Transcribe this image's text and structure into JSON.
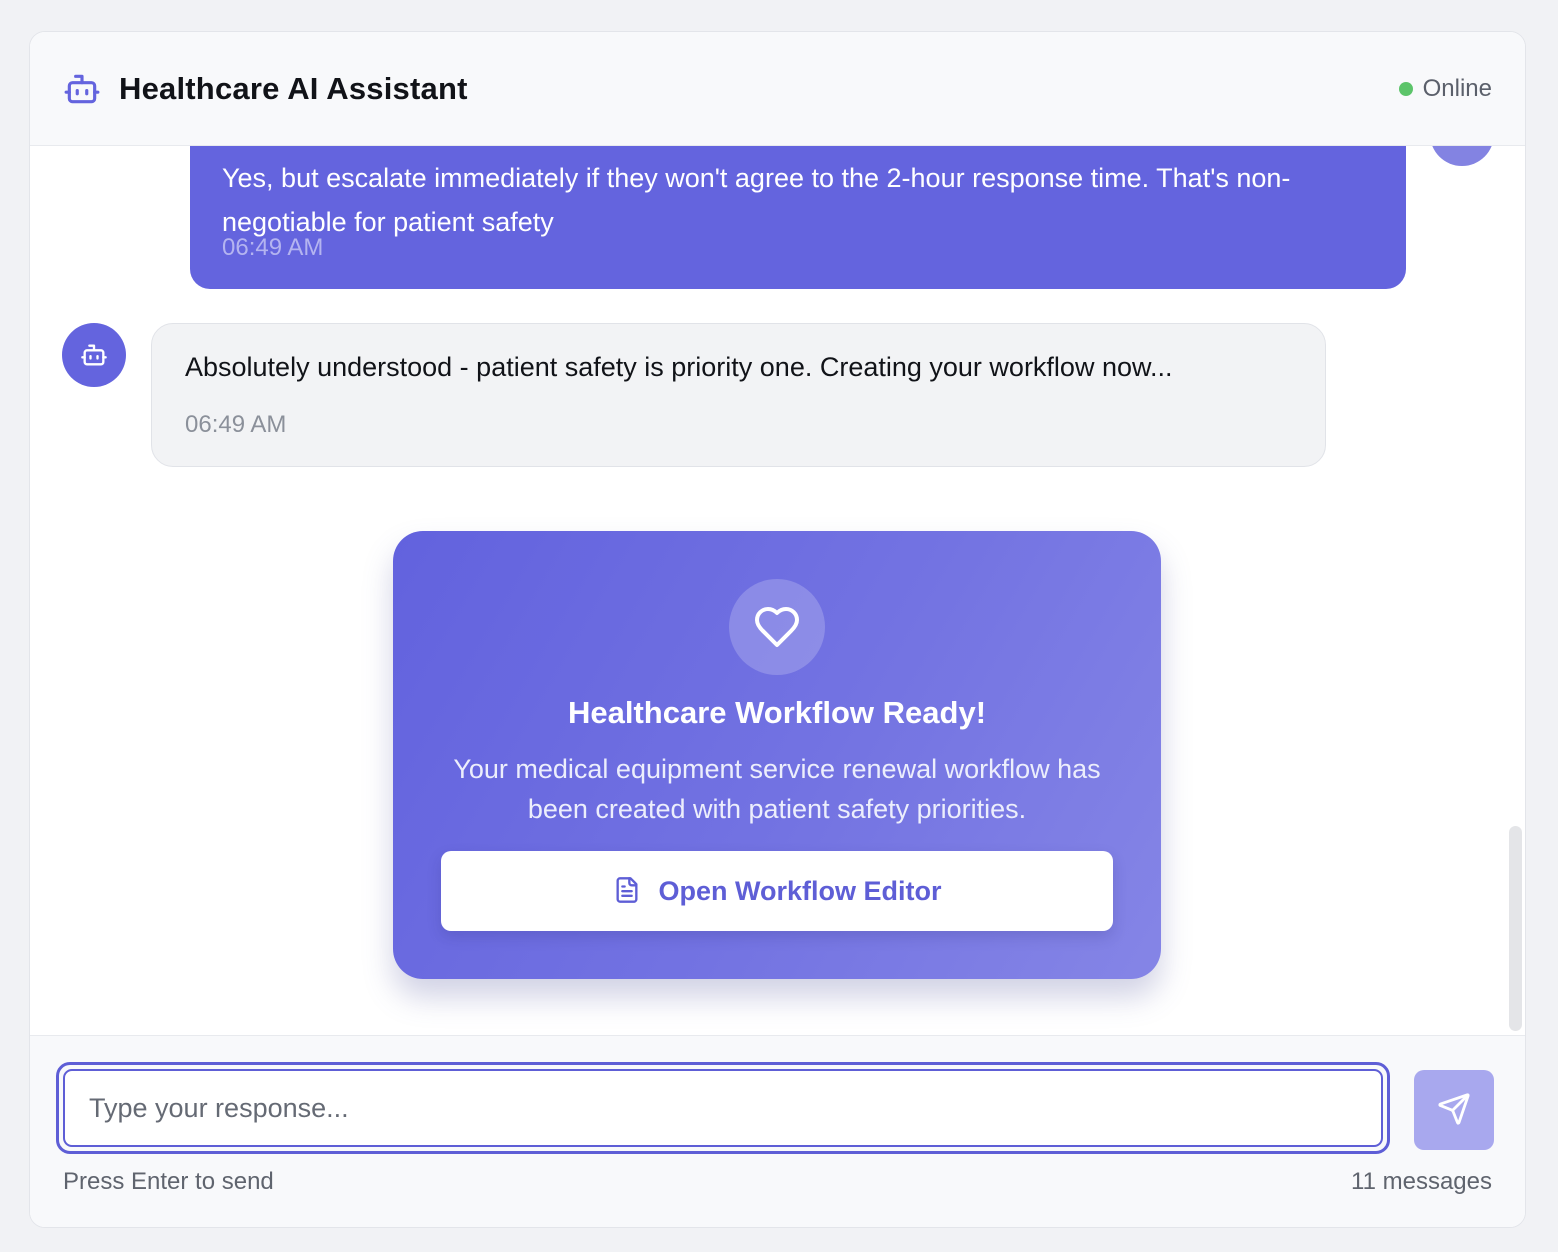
{
  "header": {
    "title": "Healthcare AI Assistant",
    "status": "Online",
    "icon": "bot-icon",
    "status_color": "#5cc46a"
  },
  "messages": [
    {
      "role": "user",
      "text": "Yes, but escalate immediately if they won't agree to the 2-hour response time. That's non-negotiable for patient safety",
      "time": "06:49 AM"
    },
    {
      "role": "assistant",
      "text": "Absolutely understood - patient safety is priority one. Creating your workflow now...",
      "time": "06:49 AM"
    }
  ],
  "card": {
    "icon": "heart-icon",
    "title": "Healthcare Workflow Ready!",
    "description": "Your medical equipment service renewal workflow has been created with patient safety priorities.",
    "button_label": "Open Workflow Editor",
    "button_icon": "document-icon"
  },
  "composer": {
    "placeholder": "Type your response...",
    "hint": "Press Enter to send",
    "count": "11 messages",
    "send_icon": "send-icon"
  },
  "colors": {
    "accent": "#6464de",
    "user_bubble": "#6464de",
    "assistant_bubble": "#f2f3f5"
  }
}
